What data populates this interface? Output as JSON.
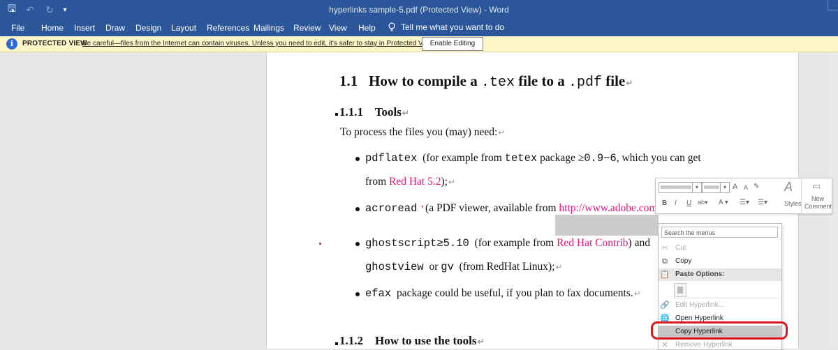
{
  "window": {
    "title": "hyperlinks sample-5.pdf (Protected View)  -  Word"
  },
  "qat": {
    "save": "🖫",
    "undo": "↶",
    "redo": "↻",
    "customize": "▾"
  },
  "ribbon": {
    "tabs": [
      "File",
      "Home",
      "Insert",
      "Draw",
      "Design",
      "Layout",
      "References",
      "Mailings",
      "Review",
      "View",
      "Help"
    ],
    "tell_me": "Tell me what you want to do"
  },
  "protected": {
    "title": "PROTECTED VIEW",
    "message": "Be careful—files from the Internet can contain viruses. Unless you need to edit, it's safer to stay in Protected View.",
    "button": "Enable Editing"
  },
  "document": {
    "h1_num": "1.1",
    "h1_pre": "How to compile a",
    "h1_code1": ".tex",
    "h1_mid": "file to a",
    "h1_code2": ".pdf",
    "h1_post": "file",
    "h2_num": "1.1.1",
    "h2_title": "Tools",
    "intro": "To process the files you (may) need:",
    "b1_code": "pdflatex",
    "b1_text1": "(for example from",
    "b1_code2": "tetex",
    "b1_text2": "package ≥",
    "b1_code3": "0.9−6",
    "b1_text3": ", which you can get",
    "b1_line2": "from",
    "b1_link": "Red Hat 5.2",
    "b1_end": ");",
    "b2_code": "acroread",
    "b2_text": "(a PDF viewer, available from",
    "b2_link": "http://www.adobe.com/",
    "b3_code": "ghostscript≥5.10",
    "b3_text1": "(for example from",
    "b3_link": "Red Hat Contrib",
    "b3_text2": ") and",
    "b3_code2": "ghostview",
    "b3_text3": "or",
    "b3_code3": "gv",
    "b3_text4": "(from RedHat Linux);",
    "b4_code": "efax",
    "b4_text": "package could be useful, if you plan to fax documents.",
    "h3_num": "1.1.2",
    "h3_title": "How to use the tools",
    "para_mark": "↵"
  },
  "mini_toolbar": {
    "grow": "A",
    "shrink": "A",
    "bold": "B",
    "italic": "I",
    "underline": "U",
    "styles": "Styles",
    "new_comment_1": "New",
    "new_comment_2": "Comment"
  },
  "context_menu": {
    "search_placeholder": "Search the menus",
    "items": {
      "cut": "Cut",
      "copy": "Copy",
      "paste_options": "Paste Options:",
      "edit_hyperlink": "Edit Hyperlink...",
      "open_hyperlink": "Open Hyperlink",
      "copy_hyperlink": "Copy Hyperlink",
      "remove_hyperlink": "Remove Hyperlink"
    }
  },
  "colors": {
    "ribbon": "#2b579a",
    "link": "#e4167c",
    "callout": "#d9181d",
    "protected_bar": "#fcf5c7"
  }
}
